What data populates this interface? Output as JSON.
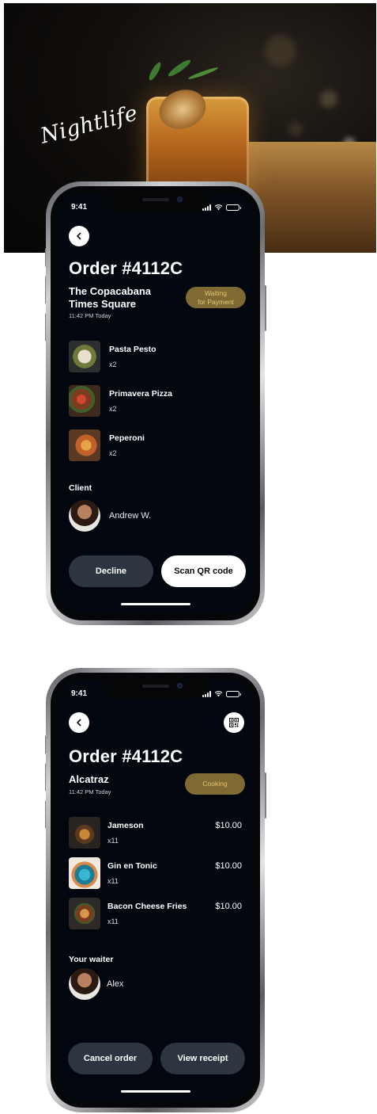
{
  "hero": {
    "script_text": "Nightlife"
  },
  "phone1": {
    "status_time": "9:41",
    "title": "Order #4112C",
    "venue_line1": "The Copacabana",
    "venue_line2": "Times Square",
    "time_text": "11:42 PM Today",
    "status_badge_line1": "Waiting",
    "status_badge_line2": "for Payment",
    "items": [
      {
        "name": "Pasta Pesto",
        "qty": "x2"
      },
      {
        "name": "Primavera Pizza",
        "qty": "x2"
      },
      {
        "name": "Peperoni",
        "qty": "x2"
      }
    ],
    "section_label": "Client",
    "person_name": "Andrew W.",
    "decline_label": "Decline",
    "scan_label": "Scan QR code"
  },
  "phone2": {
    "status_time": "9:41",
    "title": "Order #4112C",
    "venue": "Alcatraz",
    "time_text": "11:42 PM Today",
    "status_badge": "Cooking",
    "items": [
      {
        "name": "Jameson",
        "qty": "x11",
        "price": "$10.00"
      },
      {
        "name": "Gin en Tonic",
        "qty": "x11",
        "price": "$10.00"
      },
      {
        "name": "Bacon Cheese Fries",
        "qty": "x11",
        "price": "$10.00"
      }
    ],
    "section_label": "Your waiter",
    "person_name": "Alex",
    "cancel_label": "Cancel order",
    "receipt_label": "View receipt"
  },
  "colors": {
    "screen_bg": "#02070f",
    "badge_bg": "#806a33",
    "badge_text": "#e4c673",
    "dark_button": "#2d3540",
    "light_button": "#ffffff"
  },
  "icons": [
    "chevron-left-icon",
    "qr-code-icon",
    "signal-icon",
    "wifi-icon",
    "battery-icon"
  ]
}
